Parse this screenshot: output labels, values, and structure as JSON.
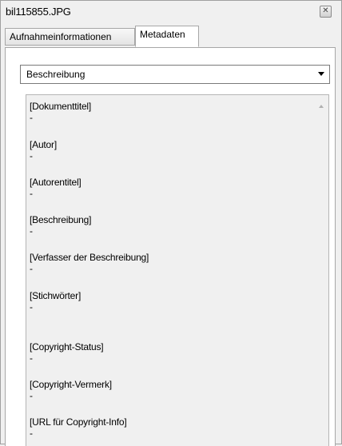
{
  "window": {
    "title": "bil115855.JPG",
    "close_symbol": "✕"
  },
  "tabs": [
    {
      "label": "Aufnahmeinformationen"
    },
    {
      "label": "Metadaten",
      "active": true
    }
  ],
  "dropdown": {
    "selected": "Beschreibung"
  },
  "fields": [
    {
      "label": "[Dokumenttitel]",
      "value": "-"
    },
    {
      "label": "[Autor]",
      "value": "-"
    },
    {
      "label": "[Autorentitel]",
      "value": "-"
    },
    {
      "label": "[Beschreibung]",
      "value": "-"
    },
    {
      "label": "[Verfasser der Beschreibung]",
      "value": "-"
    },
    {
      "label": "[Stichwörter]",
      "value": "-"
    },
    {
      "label": "[Copyright-Status]",
      "value": "-"
    },
    {
      "label": "[Copyright-Vermerk]",
      "value": "-"
    },
    {
      "label": "[URL für Copyright-Info]",
      "value": "-"
    }
  ]
}
